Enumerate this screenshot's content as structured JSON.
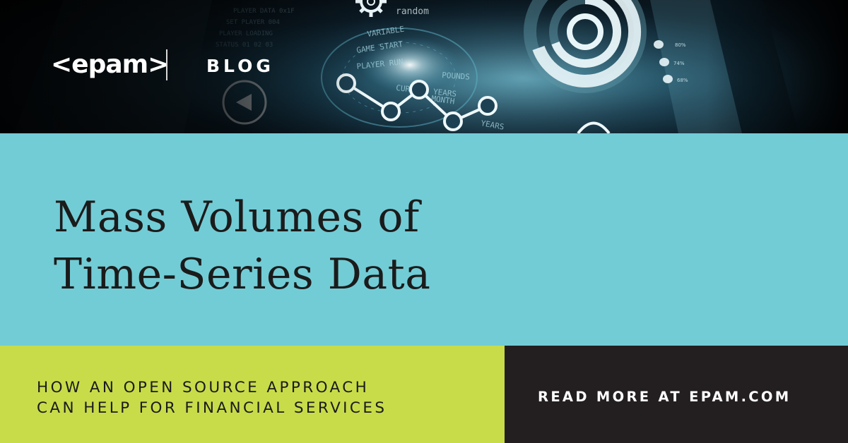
{
  "banner": {
    "logo_text": "<epam>",
    "section_label": "BLOG",
    "background_icons": [
      "gear-icon",
      "donut-chart-icon",
      "line-chart-icon",
      "play-icon"
    ],
    "background_text": [
      "random",
      "VARIABLE",
      "GAME START",
      "PLAYER RUN",
      "POUNDS",
      "CURRENT YEARS",
      "MONTH",
      "YEARS"
    ]
  },
  "main": {
    "headline_lines": [
      "Mass Volumes of",
      "Time-Series Data"
    ]
  },
  "footer": {
    "subtitle_lines": [
      "HOW AN OPEN SOURCE APPROACH",
      "CAN HELP FOR FINANCIAL SERVICES"
    ],
    "cta_label": "READ MORE AT EPAM.COM"
  },
  "colors": {
    "title_band": "#72ccd6",
    "subtitle_band": "#c8dc4a",
    "cta_band": "#231f20",
    "headline_text": "#1b1b1b",
    "banner_text": "#ffffff"
  }
}
